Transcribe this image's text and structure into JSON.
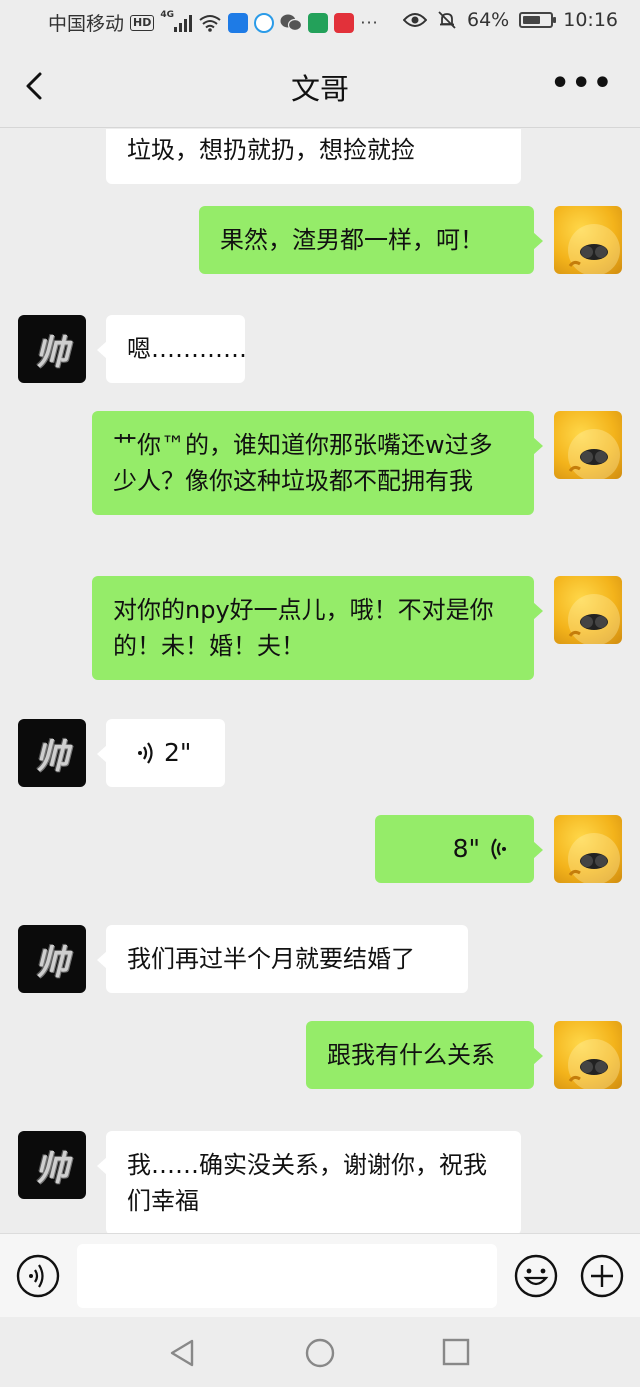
{
  "status_bar": {
    "carrier": "中国移动",
    "hd": "HD",
    "network": "4G",
    "battery": "64%",
    "battery_level": 0.64,
    "time": "10:16",
    "more": "···"
  },
  "nav": {
    "title": "文哥",
    "more": "•••"
  },
  "avatars": {
    "contact_glyph": "帅"
  },
  "messages": [
    {
      "side": "left",
      "type": "text",
      "text": "垃圾，想扔就扔，想捡就捡"
    },
    {
      "side": "right",
      "type": "text",
      "text": "果然，渣男都一样，呵！"
    },
    {
      "side": "left",
      "type": "text",
      "text": "嗯…………"
    },
    {
      "side": "right",
      "type": "text",
      "text": "艹你™的，谁知道你那张嘴还w过多少人？像你这种垃圾都不配拥有我"
    },
    {
      "side": "right",
      "type": "text",
      "text": "对你的npy好一点儿，哦！不对是你的！未！婚！夫！"
    },
    {
      "side": "left",
      "type": "voice",
      "text": "2\""
    },
    {
      "side": "right",
      "type": "voice",
      "text": "8\""
    },
    {
      "side": "left",
      "type": "text",
      "text": "我们再过半个月就要结婚了"
    },
    {
      "side": "right",
      "type": "text",
      "text": "跟我有什么关系"
    },
    {
      "side": "left",
      "type": "text",
      "text": "我……确实没关系，谢谢你，祝我们幸福"
    }
  ],
  "input_bar": {
    "placeholder": ""
  },
  "colors": {
    "background": "#ededed",
    "bubble_green": "#95ec69",
    "bubble_white": "#ffffff"
  }
}
